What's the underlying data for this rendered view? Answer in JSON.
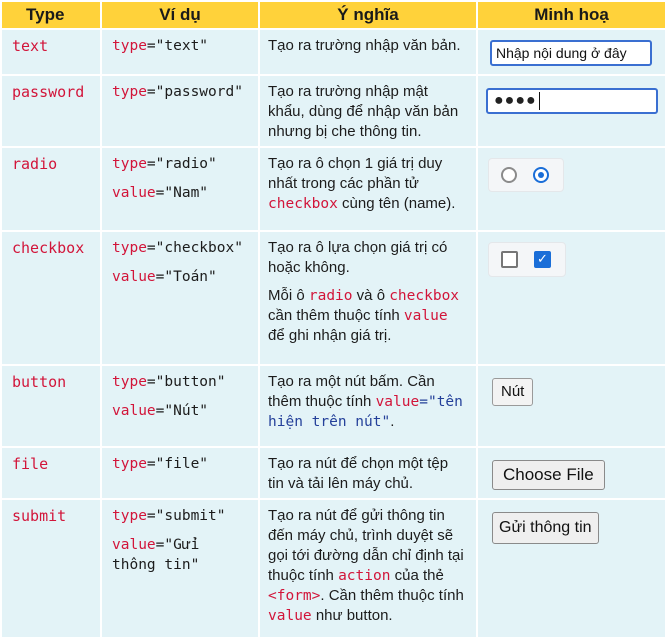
{
  "headers": [
    "Type",
    "Ví dụ",
    "Ý nghĩa",
    "Minh hoạ"
  ],
  "rows": {
    "text": {
      "type": "text",
      "ex_attr": "type",
      "ex_val": "\"text\"",
      "meaning": "Tạo ra trường nhập văn bản.",
      "demo_value": "Nhập nội dung ở đây"
    },
    "password": {
      "type": "password",
      "ex_attr": "type",
      "ex_val": "\"password\"",
      "meaning": "Tạo ra trường nhập mật khẩu, dùng để nhập văn bản nhưng bị che thông tin.",
      "demo_value": "●●●●"
    },
    "radio": {
      "type": "radio",
      "ex_attr": "type",
      "ex_val": "\"radio\"",
      "ex2_attr": "value",
      "ex2_val": "\"Nam\"",
      "meaning_a": "Tạo ra ô chọn 1 giá trị duy nhất trong các phần tử ",
      "meaning_code": "checkbox",
      "meaning_b": " cùng tên (name)."
    },
    "checkbox": {
      "type": "checkbox",
      "ex_attr": "type",
      "ex_val": "\"checkbox\"",
      "ex2_attr": "value",
      "ex2_val": "\"Toán\"",
      "meaning1": "Tạo ra ô lựa chọn giá trị có hoặc không.",
      "meaning2_a": "Mỗi ô ",
      "meaning2_code1": "radio",
      "meaning2_b": " và ô ",
      "meaning2_code2": "checkbox",
      "meaning2_c": " cần thêm thuộc tính ",
      "meaning2_code3": "value",
      "meaning2_d": " để ghi nhận giá trị."
    },
    "button": {
      "type": "button",
      "ex_attr": "type",
      "ex_val": "\"button\"",
      "ex2_attr": "value",
      "ex2_val": "\"Nút\"",
      "meaning_a": "Tạo ra một nút bấm. Cần thêm thuộc tính ",
      "meaning_code_attr": "value",
      "meaning_code_val": "=\"tên hiện trên nút\"",
      "meaning_b": ".",
      "demo_label": "Nút"
    },
    "file": {
      "type": "file",
      "ex_attr": "type",
      "ex_val": "\"file\"",
      "meaning": "Tạo ra nút để chọn một tệp tin và tải lên máy chủ.",
      "demo_label": "Choose File"
    },
    "submit": {
      "type": "submit",
      "ex_attr": "type",
      "ex_val": "\"submit\"",
      "ex2_attr": "value",
      "ex2_val": "\"Gửi thông tin\"",
      "meaning_a": "Tạo ra nút để gửi thông tin đến máy chủ, trình duyệt sẽ gọi tới đường dẫn chỉ định tại thuộc tính ",
      "meaning_code1": "action",
      "meaning_b": " của thẻ ",
      "meaning_code2": "<form>",
      "meaning_c": ". Cần thêm thuộc tính ",
      "meaning_code3": "value",
      "meaning_d": " như button.",
      "demo_label": "Gửi thông tin"
    }
  },
  "colors": {
    "header_bg": "#ffd23a",
    "row_bg": "#e3f3f7",
    "keyword": "#d2153a",
    "accent_blue": "#1a6ed8"
  }
}
